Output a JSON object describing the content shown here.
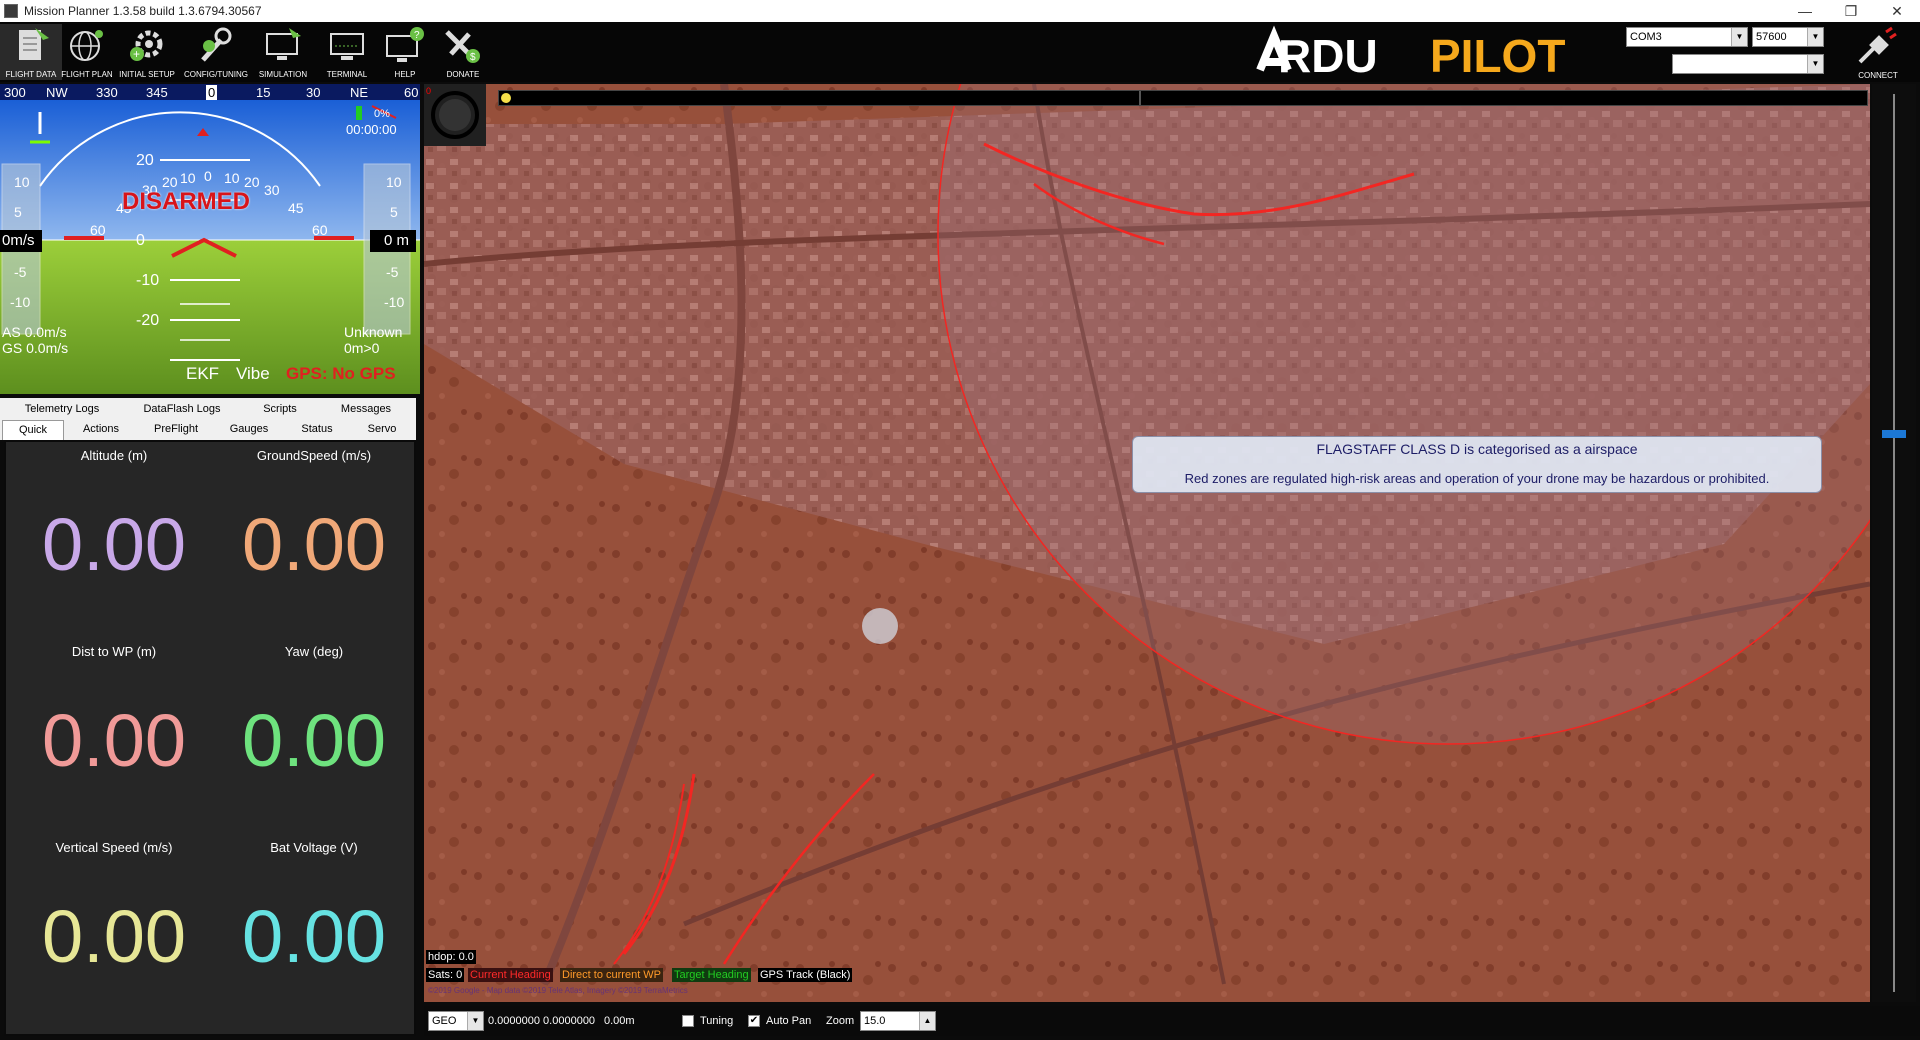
{
  "window": {
    "title": "Mission Planner 1.3.58 build 1.3.6794.30567",
    "controls": [
      "—",
      "❐",
      "✕"
    ]
  },
  "toolbar": {
    "items": [
      {
        "label": "FLIGHT DATA",
        "icon": "flight-data-icon"
      },
      {
        "label": "FLIGHT PLAN",
        "icon": "flight-plan-icon"
      },
      {
        "label": "INITIAL SETUP",
        "icon": "initial-setup-icon"
      },
      {
        "label": "CONFIG/TUNING",
        "icon": "config-tuning-icon"
      },
      {
        "label": "SIMULATION",
        "icon": "simulation-icon"
      },
      {
        "label": "TERMINAL",
        "icon": "terminal-icon"
      },
      {
        "label": "HELP",
        "icon": "help-icon"
      },
      {
        "label": "DONATE",
        "icon": "donate-icon"
      }
    ],
    "logo": "ARDUPILOT",
    "port": "COM3",
    "baud": "57600",
    "link": "",
    "connect_label": "CONNECT"
  },
  "hud": {
    "heading_labels": [
      "300",
      "NW",
      "330",
      "345",
      "0",
      "15",
      "30",
      "NE",
      "60"
    ],
    "status": "DISARMED",
    "left_speed": "0m/s",
    "right_alt": "0 m",
    "airspeed": "AS 0.0m/s",
    "groundspeed": "GS 0.0m/s",
    "mode": "Unknown",
    "wp_dist": "0m>0",
    "battery": "0%",
    "time": "00:00:00",
    "ekf": "EKF",
    "vibe": "Vibe",
    "gps": "GPS: No GPS",
    "pitch_labels": [
      "20",
      "0",
      "-10",
      "-20"
    ],
    "roll_labels": [
      "60",
      "45",
      "30",
      "20",
      "10",
      "0",
      "10",
      "20",
      "30",
      "45",
      "60"
    ],
    "tape_labels": [
      "10",
      "5",
      "-5",
      "-10"
    ]
  },
  "tabs": {
    "row1": [
      "Telemetry Logs",
      "DataFlash Logs",
      "Scripts",
      "Messages"
    ],
    "row2": [
      "Quick",
      "Actions",
      "PreFlight",
      "Gauges",
      "Status",
      "Servo"
    ]
  },
  "quick": [
    {
      "label": "Altitude (m)",
      "value": "0.00",
      "color": "#c8a8e8"
    },
    {
      "label": "GroundSpeed (m/s)",
      "value": "0.00",
      "color": "#f0a878"
    },
    {
      "label": "Dist to WP (m)",
      "value": "0.00",
      "color": "#f09a98"
    },
    {
      "label": "Yaw (deg)",
      "value": "0.00",
      "color": "#6ee27e"
    },
    {
      "label": "Vertical Speed (m/s)",
      "value": "0.00",
      "color": "#e6e696"
    },
    {
      "label": "Bat Voltage (V)",
      "value": "0.00",
      "color": "#66e2e2"
    }
  ],
  "map": {
    "notice_title": "FLAGSTAFF CLASS D is categorised as a airspace",
    "notice_body": "Red zones are regulated high-risk areas and operation of your drone may be hazardous or prohibited.",
    "hdop": "hdop: 0.0",
    "sats": "Sats: 0",
    "legend": [
      {
        "label": "Current Heading",
        "color": "#ff2a2a",
        "bg": "#3a1010"
      },
      {
        "label": "Direct to current WP",
        "color": "#ff9a2a",
        "bg": "#3a2410"
      },
      {
        "label": "Target Heading",
        "color": "#22cc22",
        "bg": "#103a10"
      },
      {
        "label": "GPS Track (Black)",
        "color": "#ffffff",
        "bg": "#000000"
      }
    ],
    "copyright": "©2019 Google - Map data ©2019 Tele Atlas, Imagery ©2019 TerraMetrics",
    "zone_color": "#ff2020"
  },
  "statusbar": {
    "coord_system": "GEO",
    "coords": "0.0000000 0.0000000",
    "alt": "0.00m",
    "tuning_label": "Tuning",
    "tuning_checked": false,
    "autopan_label": "Auto Pan",
    "autopan_checked": true,
    "zoom_label": "Zoom",
    "zoom_value": "15.0"
  }
}
